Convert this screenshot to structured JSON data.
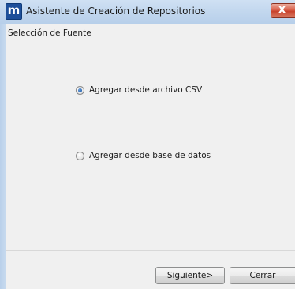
{
  "window": {
    "title": "Asistente de Creación de Repositorios",
    "app_icon_glyph": "m",
    "close_glyph": "x"
  },
  "section": {
    "label": "Selección de Fuente"
  },
  "options": [
    {
      "label": "Agregar desde archivo CSV",
      "selected": true
    },
    {
      "label": "Agregar desde base de datos",
      "selected": false
    }
  ],
  "buttons": {
    "next_label": "Siguiente>",
    "close_label": "Cerrar"
  },
  "colors": {
    "title_bar": "#c2d7ee",
    "close_button": "#c8412b",
    "app_icon": "#1d4f9a",
    "dialog_background": "#f0f0f0"
  }
}
